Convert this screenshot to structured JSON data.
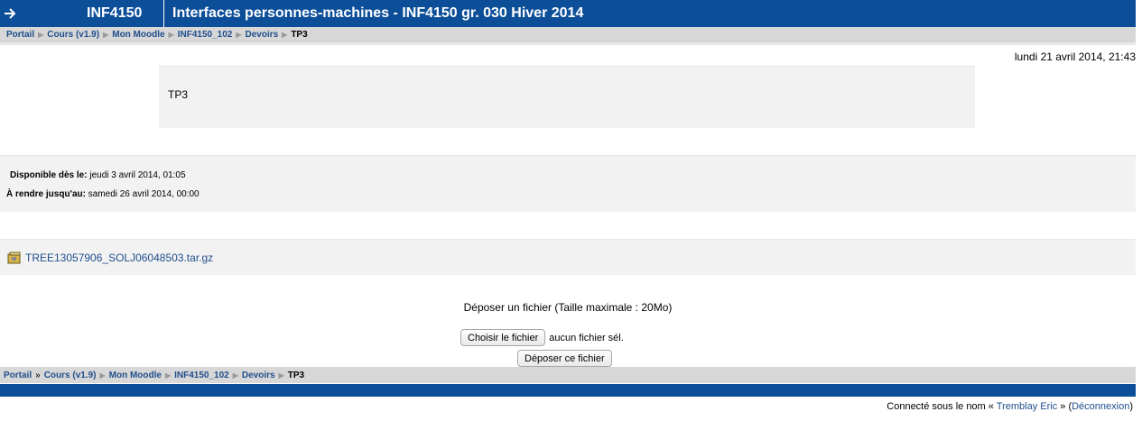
{
  "header": {
    "course_code": "INF4150",
    "title": "Interfaces personnes-machines - INF4150 gr. 030 Hiver 2014"
  },
  "breadcrumb": {
    "items": [
      "Portail",
      "Cours (v1.9)",
      "Mon Moodle",
      "INF4150_102",
      "Devoirs"
    ],
    "current": "TP3"
  },
  "date_now": "lundi 21 avril 2014, 21:43",
  "assignment": {
    "intro": "TP3",
    "available_label": "Disponible dès le:",
    "available_value": "jeudi 3 avril 2014, 01:05",
    "due_label": "À rendre jusqu'au:",
    "due_value": "samedi 26 avril 2014, 00:00",
    "file_name": "TREE13057906_SOLJ06048503.tar.gz"
  },
  "upload": {
    "text": "Déposer un fichier (Taille maximale : 20Mo)",
    "choose_button": "Choisir le fichier",
    "no_file": "aucun fichier sél.",
    "submit_button": "Déposer ce fichier"
  },
  "footer": {
    "logged_prefix": "Connecté sous le nom «",
    "user_name": "Tremblay Eric",
    "middle": "» (",
    "logout": "Déconnexion",
    "suffix": ")"
  },
  "colors": {
    "brand": "#0c4e98",
    "link": "#1f4e8c",
    "panel": "#f2f2f2"
  }
}
